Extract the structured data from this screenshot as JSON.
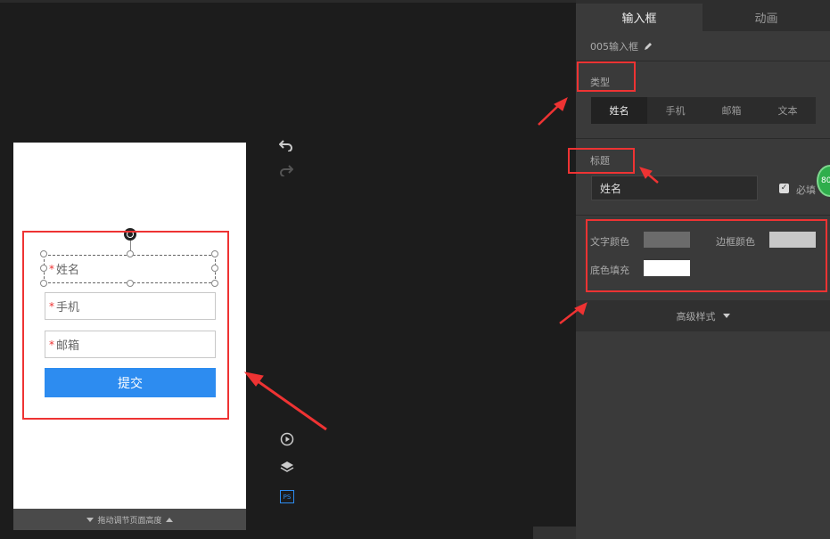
{
  "canvas": {
    "form": {
      "name_field": "姓名",
      "phone_field": "手机",
      "email_field": "邮箱",
      "required_mark": "*",
      "submit_label": "提交"
    },
    "footer_label": "拖动调节页面高度"
  },
  "toolbar": {
    "undo_icon": "undo-icon",
    "redo_icon": "redo-icon",
    "play_icon": "play-icon",
    "layers_icon": "layers-icon",
    "ps_label": "PS"
  },
  "panel": {
    "tabs": [
      {
        "label": "输入框",
        "active": true
      },
      {
        "label": "动画",
        "active": false
      }
    ],
    "component_name": "005输入框",
    "type_label": "类型",
    "type_options": [
      {
        "label": "姓名",
        "active": true
      },
      {
        "label": "手机",
        "active": false
      },
      {
        "label": "邮箱",
        "active": false
      },
      {
        "label": "文本",
        "active": false
      }
    ],
    "title_label": "标题",
    "title_value": "姓名",
    "required_label": "必填",
    "text_color_label": "文字颜色",
    "border_color_label": "边框颜色",
    "fill_color_label": "底色填充",
    "advanced_label": "高级样式",
    "badge_text": "80"
  },
  "colors": {
    "text_color": "#6b6b6b",
    "border_color": "#c8c8c8",
    "fill_color": "#ffffff",
    "accent": "#2d8cf0",
    "annotation_red": "#e33333"
  }
}
